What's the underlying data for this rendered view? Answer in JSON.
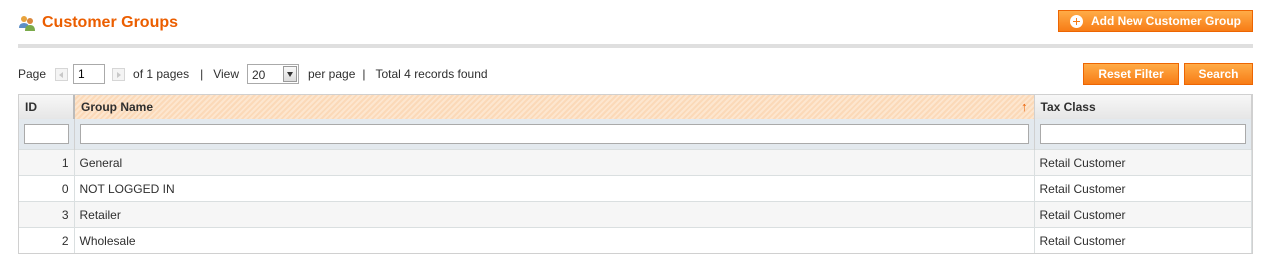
{
  "header": {
    "title": "Customer Groups",
    "add_button": "Add New Customer Group"
  },
  "pager": {
    "page_label": "Page",
    "page_value": "1",
    "of_pages": "of 1 pages",
    "separator": "|",
    "view_label": "View",
    "per_page_value": "20",
    "per_page_label": "per page",
    "total": "Total 4 records found"
  },
  "actions": {
    "reset_filter": "Reset Filter",
    "search": "Search"
  },
  "grid": {
    "columns": [
      "ID",
      "Group Name",
      "Tax Class"
    ],
    "sort_indicator": "↑",
    "rows": [
      {
        "id": "1",
        "name": "General",
        "tax": "Retail Customer"
      },
      {
        "id": "0",
        "name": "NOT LOGGED IN",
        "tax": "Retail Customer"
      },
      {
        "id": "3",
        "name": "Retailer",
        "tax": "Retail Customer"
      },
      {
        "id": "2",
        "name": "Wholesale",
        "tax": "Retail Customer"
      }
    ]
  },
  "colors": {
    "accent": "#eb5e00",
    "button": "#f77c16",
    "filter_row": "#e3e9ee",
    "sorted_header": "#fde6cf"
  },
  "icons": {
    "title": "customer-group-icon",
    "add": "plus-circle-icon"
  }
}
